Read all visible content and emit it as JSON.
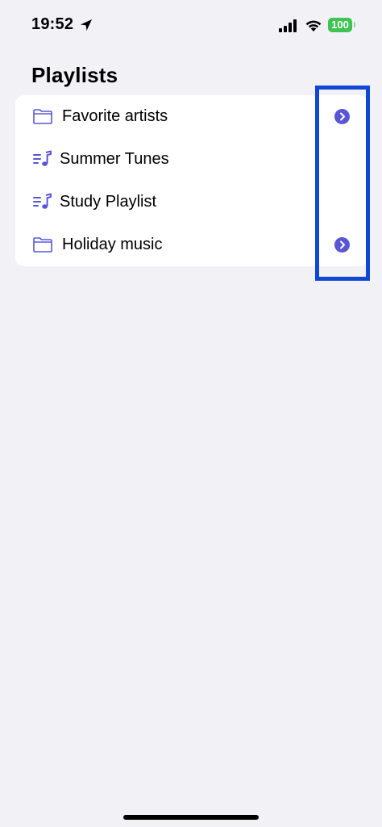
{
  "status_bar": {
    "time": "19:52",
    "battery": "100",
    "icons": [
      "location-arrow-icon",
      "cellular-signal-icon",
      "wifi-icon",
      "battery-icon"
    ]
  },
  "title": "Playlists",
  "accent_color": "#5856d6",
  "battery_color": "#3ec450",
  "highlight_color": "#1147d8",
  "playlists": [
    {
      "label": "Favorite artists",
      "icon": "folder-icon",
      "has_disclosure": true
    },
    {
      "label": "Summer Tunes",
      "icon": "music-list-icon",
      "has_disclosure": false
    },
    {
      "label": "Study Playlist",
      "icon": "music-list-icon",
      "has_disclosure": false
    },
    {
      "label": "Holiday music",
      "icon": "folder-icon",
      "has_disclosure": true
    }
  ]
}
